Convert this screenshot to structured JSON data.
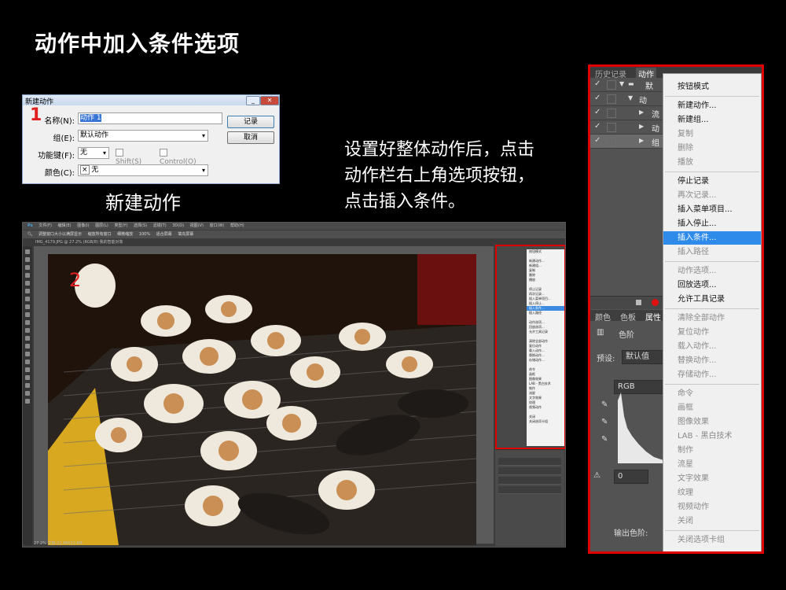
{
  "page": {
    "title": "动作中加入条件选项",
    "caption_dialog": "新建动作",
    "instruction": [
      "设置好整体动作后，点击",
      "动作栏右上角选项按钮，",
      "点击插入条件。"
    ],
    "markers": [
      "1",
      "2"
    ]
  },
  "dialog": {
    "title": "新建动作",
    "fields": {
      "name_label": "名称(N):",
      "name_value": "动作 1",
      "group_label": "组(E):",
      "group_value": "默认动作",
      "fkey_label": "功能键(F):",
      "fkey_value": "无",
      "shift_label": "Shift(S)",
      "control_label": "Control(O)",
      "color_label": "颜色(C):",
      "color_value": "无",
      "color_icon": "×"
    },
    "buttons": {
      "record": "记录",
      "cancel": "取消"
    }
  },
  "ps": {
    "menubar": [
      "文件(F)",
      "编辑(E)",
      "图像(I)",
      "图层(L)",
      "类型(Y)",
      "选择(S)",
      "滤镜(T)",
      "3D(D)",
      "视图(V)",
      "窗口(W)",
      "帮助(H)"
    ],
    "options": [
      "调整窗口大小以满屏显示",
      "缩放所有窗口",
      "细微缩放",
      "100%",
      "适合屏幕",
      "填充屏幕"
    ],
    "tab": "IMG_4179.JPG @ 27.2% (RGB/8) 我的智能对象",
    "status": "27.2%    文档:22.6M/22.6M",
    "mini_menu": [
      "按钮模式",
      "",
      "新建动作...",
      "新建组...",
      "复制",
      "删除",
      "播放",
      "",
      "停止记录",
      "再次记录...",
      "插入菜单项目...",
      "插入停止...",
      "插入条件...",
      "插入路径",
      "",
      "动作选项...",
      "回放选项...",
      "允许工具记录",
      "",
      "清除全部动作",
      "复位动作",
      "载入动作...",
      "替换动作...",
      "存储动作...",
      "",
      "命令",
      "画框",
      "图像效果",
      "LAB - 黑白技术",
      "制作",
      "流星",
      "文字效果",
      "纹理",
      "视频动作",
      "",
      "关闭",
      "关闭选项卡组"
    ],
    "mini_highlight": "插入条件..."
  },
  "panel": {
    "tabs": {
      "history": "历史记录",
      "actions": "动作"
    },
    "rows": [
      {
        "check": "✓",
        "text": "默"
      },
      {
        "check": "✓",
        "text": "动"
      },
      {
        "check": "✓",
        "text": "流"
      },
      {
        "check": "✓",
        "text": "动"
      },
      {
        "check": "✓",
        "text": "组"
      }
    ],
    "props_tabs": {
      "color": "颜色",
      "swatch": "色板",
      "props": "属性"
    },
    "props": {
      "levels": "色阶",
      "preset_label": "预设:",
      "preset_value": "默认值",
      "channel": "RGB",
      "input_value": "0",
      "output_label": "输出色阶:"
    },
    "menu": {
      "items": [
        {
          "label": "按钮模式",
          "state": "normal"
        },
        {
          "label": "新建动作...",
          "state": "normal"
        },
        {
          "label": "新建组...",
          "state": "normal"
        },
        {
          "label": "复制",
          "state": "disabled"
        },
        {
          "label": "删除",
          "state": "disabled"
        },
        {
          "label": "播放",
          "state": "disabled"
        },
        {
          "label": "停止记录",
          "state": "normal"
        },
        {
          "label": "再次记录...",
          "state": "disabled"
        },
        {
          "label": "插入菜单项目...",
          "state": "normal"
        },
        {
          "label": "插入停止...",
          "state": "normal"
        },
        {
          "label": "插入条件...",
          "state": "highlighted"
        },
        {
          "label": "插入路径",
          "state": "disabled"
        },
        {
          "label": "动作选项...",
          "state": "disabled"
        },
        {
          "label": "回放选项...",
          "state": "normal"
        },
        {
          "label": "允许工具记录",
          "state": "normal"
        },
        {
          "label": "清除全部动作",
          "state": "disabled"
        },
        {
          "label": "复位动作",
          "state": "disabled"
        },
        {
          "label": "载入动作...",
          "state": "disabled"
        },
        {
          "label": "替换动作...",
          "state": "disabled"
        },
        {
          "label": "存储动作...",
          "state": "disabled"
        },
        {
          "label": "命令",
          "state": "disabled"
        },
        {
          "label": "画框",
          "state": "disabled"
        },
        {
          "label": "图像效果",
          "state": "disabled"
        },
        {
          "label": "LAB - 黑白技术",
          "state": "disabled"
        },
        {
          "label": "制作",
          "state": "disabled"
        },
        {
          "label": "流星",
          "state": "disabled"
        },
        {
          "label": "文字效果",
          "state": "disabled"
        },
        {
          "label": "纹理",
          "state": "disabled"
        },
        {
          "label": "视频动作",
          "state": "disabled"
        },
        {
          "label": "关闭",
          "state": "disabled"
        },
        {
          "label": "关闭选项卡组",
          "state": "disabled"
        }
      ]
    }
  },
  "colors": {
    "highlight": "#e00000",
    "menu_highlight": "#2f8bea",
    "background": "#000000"
  }
}
